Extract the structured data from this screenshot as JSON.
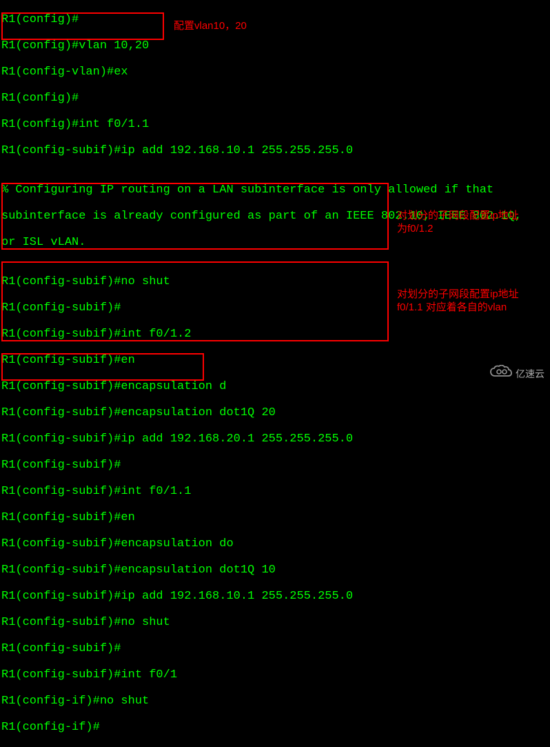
{
  "terminal": {
    "lines": [
      "R1(config)#",
      "R1(config)#vlan 10,20",
      "R1(config-vlan)#ex",
      "R1(config)#",
      "R1(config)#int f0/1.1",
      "R1(config-subif)#ip add 192.168.10.1 255.255.255.0",
      "",
      "% Configuring IP routing on a LAN subinterface is only allowed if that",
      "subinterface is already configured as part of an IEEE 802.10, IEEE 802.1Q,",
      "or ISL vLAN.",
      "",
      "R1(config-subif)#no shut",
      "R1(config-subif)#",
      "R1(config-subif)#int f0/1.2",
      "R1(config-subif)#en",
      "R1(config-subif)#encapsulation d",
      "R1(config-subif)#encapsulation dot1Q 20",
      "R1(config-subif)#ip add 192.168.20.1 255.255.255.0",
      "R1(config-subif)#",
      "R1(config-subif)#int f0/1.1",
      "R1(config-subif)#en",
      "R1(config-subif)#encapsulation do",
      "R1(config-subif)#encapsulation dot1Q 10",
      "R1(config-subif)#ip add 192.168.10.1 255.255.255.0",
      "R1(config-subif)#no shut",
      "R1(config-subif)#",
      "R1(config-subif)#int f0/1",
      "R1(config-if)#no shut",
      "R1(config-if)#"
    ]
  },
  "annotations": {
    "a1": "配置vlan10，20",
    "a2_line1": "对划分的子网段配置ip地址",
    "a2_line2": "为f0/1.2",
    "a3_line1": "对划分的子网段配置ip地址",
    "a3_line2": "f0/1.1  对应着各自的vlan"
  },
  "watermark": {
    "text": "亿速云"
  },
  "colors": {
    "bg": "#000000",
    "fg": "#00ff00",
    "annotation": "#ff0000",
    "watermark": "#aaaaaa"
  }
}
